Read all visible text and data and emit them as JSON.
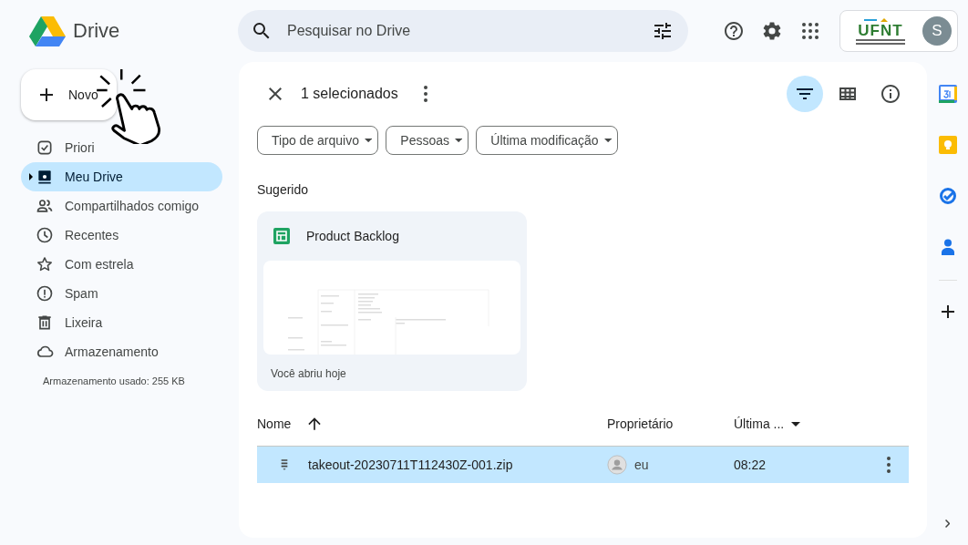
{
  "app": {
    "title": "Drive"
  },
  "search": {
    "placeholder": "Pesquisar no Drive"
  },
  "account": {
    "logo_text": "UFNT",
    "avatar_initial": "S"
  },
  "new_button": {
    "label": "Novo"
  },
  "sidebar": {
    "items": [
      {
        "kind": "priority",
        "label": "Priori",
        "selected": false
      },
      {
        "kind": "drive",
        "label": "Meu Drive",
        "selected": true
      },
      {
        "kind": "shared",
        "label": "Compartilhados comigo",
        "selected": false
      },
      {
        "kind": "recent",
        "label": "Recentes",
        "selected": false
      },
      {
        "kind": "starred",
        "label": "Com estrela",
        "selected": false
      },
      {
        "kind": "spam",
        "label": "Spam",
        "selected": false
      },
      {
        "kind": "trash",
        "label": "Lixeira",
        "selected": false
      },
      {
        "kind": "storage",
        "label": "Armazenamento",
        "selected": false
      }
    ],
    "storage_usage": "Armazenamento usado: 255 KB"
  },
  "selection_bar": {
    "count": "1 selecionados"
  },
  "view_buttons": [
    {
      "kind": "filter",
      "selected": true
    },
    {
      "kind": "grid",
      "selected": false
    },
    {
      "kind": "info",
      "selected": false
    }
  ],
  "filters": [
    "Tipo de arquivo",
    "Pessoas",
    "Última modificação"
  ],
  "suggested": {
    "heading": "Sugerido",
    "cards": [
      {
        "title": "Product Backlog",
        "subtitle": "Você abriu hoje"
      }
    ]
  },
  "table": {
    "columns": [
      "Nome",
      "Proprietário",
      "Última ..."
    ],
    "rows": [
      {
        "name": "takeout-20230711T112430Z-001.zip",
        "owner": "eu",
        "modified": "08:22",
        "selected": true
      }
    ]
  }
}
